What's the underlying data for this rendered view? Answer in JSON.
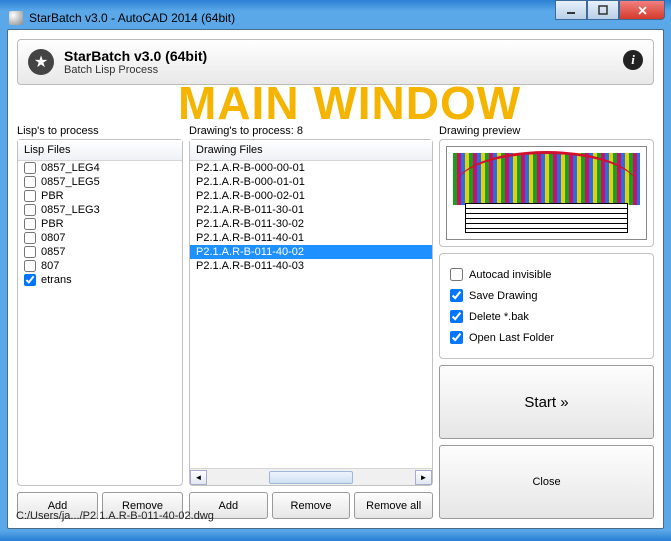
{
  "window": {
    "title": "StarBatch v3.0 - AutoCAD 2014 (64bit)"
  },
  "header": {
    "title": "StarBatch v3.0 (64bit)",
    "subtitle": "Batch Lisp Process",
    "info_glyph": "i"
  },
  "overlay": "MAIN WINDOW",
  "lisps": {
    "label": "Lisp's to process",
    "column": "Lisp Files",
    "items": [
      {
        "label": "0857_LEG4",
        "checked": false
      },
      {
        "label": "0857_LEG5",
        "checked": false
      },
      {
        "label": "PBR",
        "checked": false
      },
      {
        "label": "0857_LEG3",
        "checked": false
      },
      {
        "label": "PBR",
        "checked": false
      },
      {
        "label": "0807",
        "checked": false
      },
      {
        "label": "0857",
        "checked": false
      },
      {
        "label": "807",
        "checked": false
      },
      {
        "label": "etrans",
        "checked": true
      }
    ],
    "add": "Add",
    "remove": "Remove"
  },
  "drawings": {
    "label": "Drawing's to process: 8",
    "column": "Drawing Files",
    "items": [
      "P2.1.A.R-B-000-00-01",
      "P2.1.A.R-B-000-01-01",
      "P2.1.A.R-B-000-02-01",
      "P2.1.A.R-B-011-30-01",
      "P2.1.A.R-B-011-30-02",
      "P2.1.A.R-B-011-40-01",
      "P2.1.A.R-B-011-40-02",
      "P2.1.A.R-B-011-40-03"
    ],
    "selected_index": 6,
    "add": "Add",
    "remove": "Remove",
    "remove_all": "Remove all"
  },
  "preview": {
    "label": "Drawing preview"
  },
  "options": {
    "autocad_invisible": {
      "label": "Autocad invisible",
      "checked": false
    },
    "save_drawing": {
      "label": "Save Drawing",
      "checked": true
    },
    "delete_bak": {
      "label": "Delete *.bak",
      "checked": true
    },
    "open_last_folder": {
      "label": "Open Last Folder",
      "checked": true
    }
  },
  "buttons": {
    "start": "Start »",
    "close": "Close"
  },
  "statusbar": "C:/Users/ja.../P2.1.A.R-B-011-40-02.dwg"
}
